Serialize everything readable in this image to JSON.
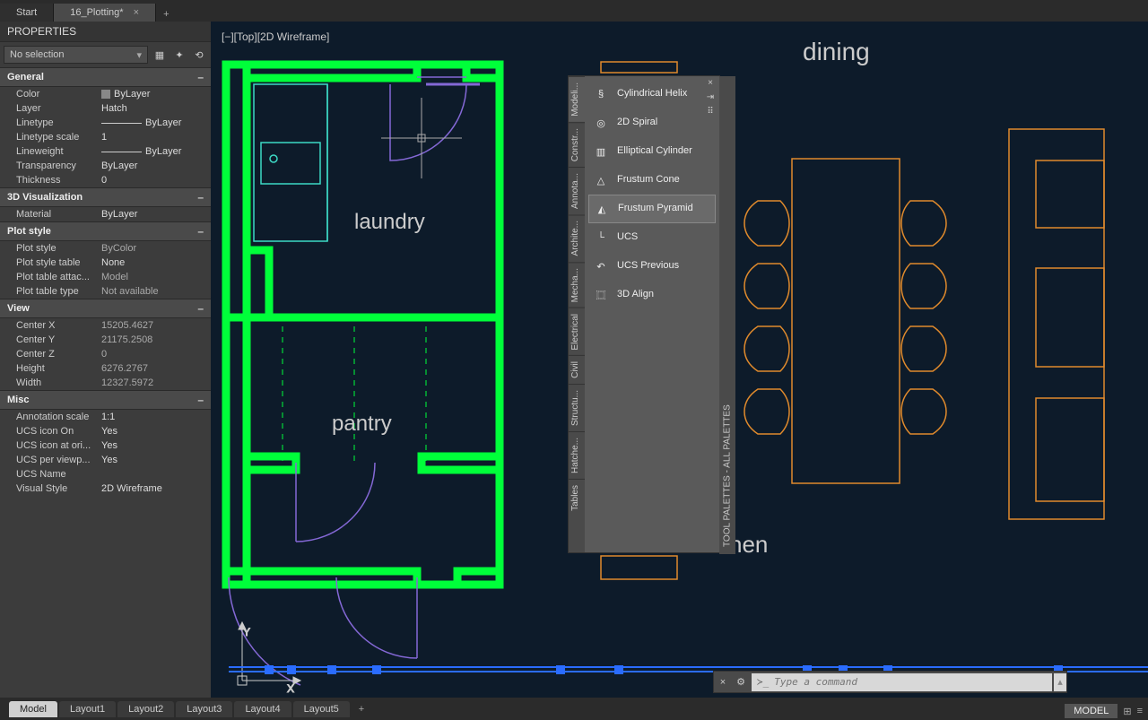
{
  "top_tabs": {
    "start": "Start",
    "active": "16_Plotting*"
  },
  "properties": {
    "title": "PROPERTIES",
    "selector": "No selection",
    "groups": {
      "general": {
        "title": "General",
        "color_label": "Color",
        "color_value": "ByLayer",
        "layer_label": "Layer",
        "layer_value": "Hatch",
        "linetype_label": "Linetype",
        "linetype_value": "ByLayer",
        "ltscale_label": "Linetype scale",
        "ltscale_value": "1",
        "lineweight_label": "Lineweight",
        "lineweight_value": "ByLayer",
        "transparency_label": "Transparency",
        "transparency_value": "ByLayer",
        "thickness_label": "Thickness",
        "thickness_value": "0"
      },
      "viz3d": {
        "title": "3D Visualization",
        "material_label": "Material",
        "material_value": "ByLayer"
      },
      "plot": {
        "title": "Plot style",
        "ps_label": "Plot style",
        "ps_value": "ByColor",
        "pst_label": "Plot style table",
        "pst_value": "None",
        "pta_label": "Plot table attac...",
        "pta_value": "Model",
        "ptt_label": "Plot table type",
        "ptt_value": "Not available"
      },
      "view": {
        "title": "View",
        "cx_label": "Center X",
        "cx_value": "15205.4627",
        "cy_label": "Center Y",
        "cy_value": "21175.2508",
        "cz_label": "Center Z",
        "cz_value": "0",
        "h_label": "Height",
        "h_value": "6276.2767",
        "w_label": "Width",
        "w_value": "12327.5972"
      },
      "misc": {
        "title": "Misc",
        "as_label": "Annotation scale",
        "as_value": "1:1",
        "uio_label": "UCS icon On",
        "uio_value": "Yes",
        "uao_label": "UCS icon at ori...",
        "uao_value": "Yes",
        "upv_label": "UCS per viewp...",
        "upv_value": "Yes",
        "un_label": "UCS Name",
        "un_value": "",
        "vs_label": "Visual Style",
        "vs_value": "2D Wireframe"
      }
    }
  },
  "viewport_label": "[−][Top][2D Wireframe]",
  "canvas_labels": {
    "laundry": "laundry",
    "pantry": "pantry",
    "dining": "dining",
    "kitchen": "chen"
  },
  "palette": {
    "title": "TOOL PALETTES - ALL PALETTES",
    "sidetabs": [
      "Modeli...",
      "Constr...",
      "Annota...",
      "Archite...",
      "Mecha...",
      "Electrical",
      "Civil",
      "Structu...",
      "Hatche...",
      "Tables"
    ],
    "items": {
      "cyl_helix": "Cylindrical Helix",
      "spiral": "2D Spiral",
      "ell_cyl": "Elliptical Cylinder",
      "f_cone": "Frustum Cone",
      "f_pyr": "Frustum Pyramid",
      "ucs": "UCS",
      "ucs_prev": "UCS Previous",
      "align3d": "3D Align"
    }
  },
  "command": {
    "placeholder": "Type a command"
  },
  "bottom_tabs": {
    "model": "Model",
    "l1": "Layout1",
    "l2": "Layout2",
    "l3": "Layout3",
    "l4": "Layout4",
    "l5": "Layout5"
  },
  "status": {
    "model": "MODEL"
  }
}
